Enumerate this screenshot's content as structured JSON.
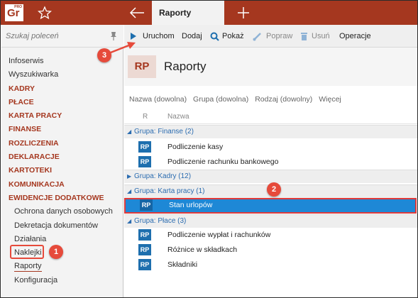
{
  "app": {
    "logo_text": "Gr",
    "logo_badge": "PRO",
    "active_tab": "Raporty",
    "accent_color": "#a5371f",
    "icons": [
      "star-icon",
      "back-arrow-icon",
      "plus-icon",
      "pin-icon",
      "play-icon",
      "search-icon",
      "brush-icon",
      "trash-icon"
    ]
  },
  "sidebar": {
    "search_placeholder": "Szukaj poleceń",
    "items": [
      {
        "label": "Infoserwis",
        "kind": "plain"
      },
      {
        "label": "Wyszukiwarka",
        "kind": "plain"
      },
      {
        "label": "KADRY",
        "kind": "section"
      },
      {
        "label": "PŁACE",
        "kind": "section"
      },
      {
        "label": "KARTA PRACY",
        "kind": "section"
      },
      {
        "label": "FINANSE",
        "kind": "section"
      },
      {
        "label": "ROZLICZENIA",
        "kind": "section"
      },
      {
        "label": "DEKLARACJE",
        "kind": "section"
      },
      {
        "label": "KARTOTEKI",
        "kind": "section"
      },
      {
        "label": "KOMUNIKACJA",
        "kind": "section"
      },
      {
        "label": "EWIDENCJE DODATKOWE",
        "kind": "section"
      },
      {
        "label": "Ochrona danych osobowych",
        "kind": "sub"
      },
      {
        "label": "Dekretacja dokumentów",
        "kind": "sub"
      },
      {
        "label": "Działania",
        "kind": "sub"
      },
      {
        "label": "Naklejki",
        "kind": "sub"
      },
      {
        "label": "Raporty",
        "kind": "sub"
      },
      {
        "label": "Konfiguracja",
        "kind": "sub"
      }
    ]
  },
  "toolbar": {
    "run_label": "Uruchom",
    "add_label": "Dodaj",
    "show_label": "Pokaż",
    "edit_label": "Popraw",
    "delete_label": "Usuń",
    "ops_label": "Operacje"
  },
  "header": {
    "badge": "RP",
    "title": "Raporty"
  },
  "filters": {
    "name": "Nazwa (dowolna)",
    "group": "Grupa (dowolna)",
    "kind": "Rodzaj (dowolny)",
    "more": "Więcej"
  },
  "columns": {
    "r": "R",
    "name": "Nazwa"
  },
  "groups": [
    {
      "label": "Grupa:",
      "name": "Finanse (2)",
      "expanded": true,
      "rows": [
        {
          "icon": "RP",
          "name": "Podliczenie kasy"
        },
        {
          "icon": "RP",
          "name": "Podliczenie rachunku bankowego"
        }
      ]
    },
    {
      "label": "Grupa:",
      "name": "Kadry (12)",
      "expanded": false,
      "rows": []
    },
    {
      "label": "Grupa:",
      "name": "Karta pracy (1)",
      "expanded": true,
      "rows": [
        {
          "icon": "RP",
          "name": "Stan urlopów",
          "selected": true
        }
      ]
    },
    {
      "label": "Grupa:",
      "name": "Płace (3)",
      "expanded": true,
      "rows": [
        {
          "icon": "RP",
          "name": "Podliczenie wypłat i rachunków"
        },
        {
          "icon": "RP",
          "name": "Różnice w składkach"
        },
        {
          "icon": "RP",
          "name": "Składniki"
        }
      ]
    }
  ],
  "callouts": [
    "1",
    "2",
    "3"
  ],
  "callout_color": "#e64a3b",
  "selection_color": "#1e88d6"
}
